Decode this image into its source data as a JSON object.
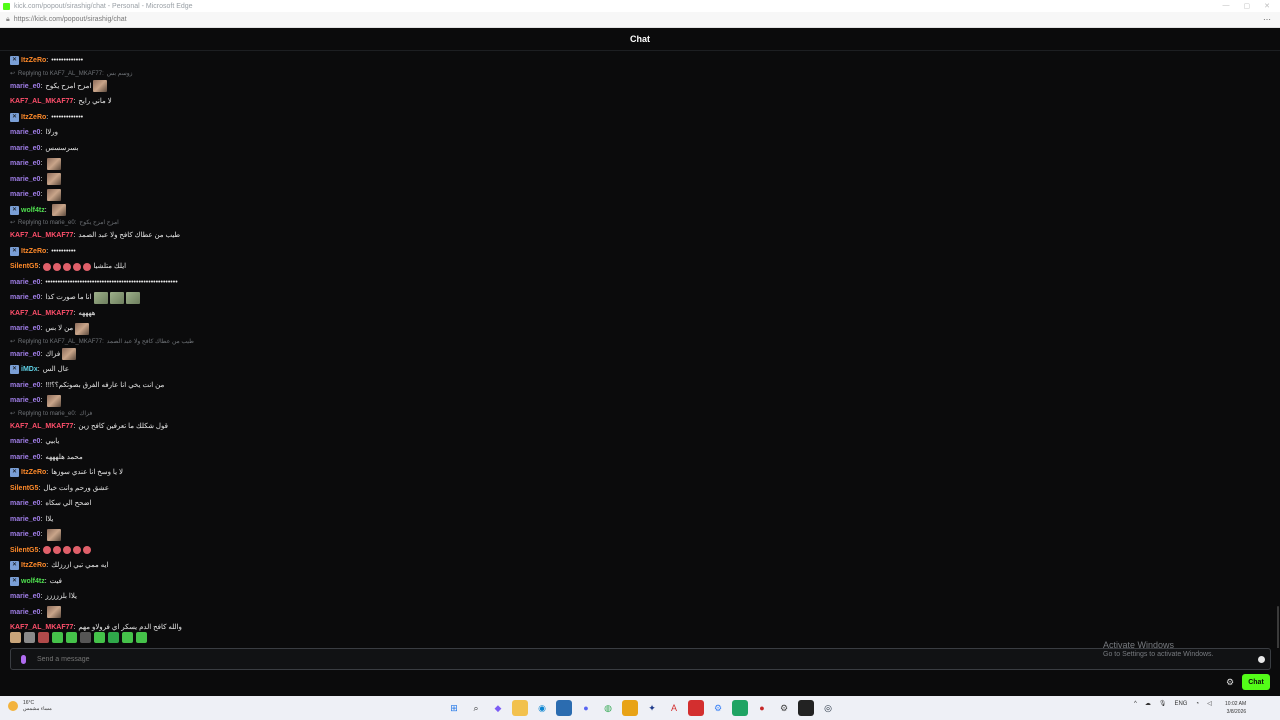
{
  "window": {
    "title": "kick.com/popout/sirashig/chat - Personal - Microsoft Edge",
    "url": "https://kick.com/popout/sirashig/chat"
  },
  "chat": {
    "header": "Chat",
    "colors": {
      "accent": "#53fc18",
      "bg": "#0b0b0c"
    },
    "messages": [
      {
        "user": "ItzZeRo",
        "color": "#ff8a2a",
        "badge": true,
        "text": "•••••••••••••"
      },
      {
        "reply_to": "Replying to KAF7_AL_MKAF77:",
        "reply_text": "زوسم بس",
        "user": "marie_e0",
        "color": "#a07ee8",
        "text": "امزح امزح يكوح",
        "emotes": 1
      },
      {
        "user": "KAF7_AL_MKAF77",
        "color": "#ff4f6b",
        "text": "لا ماني رايح"
      },
      {
        "user": "ItzZeRo",
        "color": "#ff8a2a",
        "badge": true,
        "text": "•••••••••••••"
      },
      {
        "user": "marie_e0",
        "color": "#a07ee8",
        "text": "ورلاا"
      },
      {
        "user": "marie_e0",
        "color": "#a07ee8",
        "text": "بسرسسس"
      },
      {
        "user": "marie_e0",
        "color": "#a07ee8",
        "text": "",
        "emotes": 1
      },
      {
        "user": "marie_e0",
        "color": "#a07ee8",
        "text": "",
        "emotes": 1
      },
      {
        "user": "marie_e0",
        "color": "#a07ee8",
        "text": "",
        "emotes": 1
      },
      {
        "user": "wolf4tz",
        "color": "#4fe04f",
        "badge": true,
        "text": "",
        "emotes": 1
      },
      {
        "reply_to": "Replying to marie_e0:",
        "reply_text": "امزح امزح يكوح",
        "user": "KAF7_AL_MKAF77",
        "color": "#ff4f6b",
        "text": "طيب من عطاك كافح ولا عبد الصمد"
      },
      {
        "user": "ItzZeRo",
        "color": "#ff8a2a",
        "badge": true,
        "text": "••••••••••"
      },
      {
        "user": "SilentG5",
        "color": "#ff8a2a",
        "text": "ايلك متلشيا",
        "smiles": 5
      },
      {
        "user": "marie_e0",
        "color": "#a07ee8",
        "text": "••••••••••••••••••••••••••••••••••••••••••••••••••••••"
      },
      {
        "user": "marie_e0",
        "color": "#a07ee8",
        "text": "انا ما صورت كذا",
        "emotes": 3
      },
      {
        "user": "KAF7_AL_MKAF77",
        "color": "#ff4f6b",
        "text": "ههههه"
      },
      {
        "user": "marie_e0",
        "color": "#a07ee8",
        "text": "من لا بس",
        "emotes": 1
      },
      {
        "reply_to": "Replying to KAF7_AL_MKAF77:",
        "reply_text": "طيب من عطاك كافح ولا عبد الصمد",
        "user": "marie_e0",
        "color": "#a07ee8",
        "text": "فزاك",
        "emotes": 1
      },
      {
        "user": "iMDx",
        "color": "#5fd3e8",
        "badge": true,
        "text": "عال الس"
      },
      {
        "user": "marie_e0",
        "color": "#a07ee8",
        "text": "!!!من انت يخي انا عارفه الفرق بصوتكم؟؟"
      },
      {
        "user": "marie_e0",
        "color": "#a07ee8",
        "text": "",
        "emotes": 1
      },
      {
        "reply_to": "Replying to marie_e0:",
        "reply_text": "فزاك",
        "user": "KAF7_AL_MKAF77",
        "color": "#ff4f6b",
        "text": "قول شكلك ما تعرفين كافح زين"
      },
      {
        "user": "marie_e0",
        "color": "#a07ee8",
        "text": "يابيي"
      },
      {
        "user": "marie_e0",
        "color": "#a07ee8",
        "text": "محمد هلهههه"
      },
      {
        "user": "ItzZeRo",
        "color": "#ff8a2a",
        "badge": true,
        "text": "لا يا وسخ انا عندي سوزها"
      },
      {
        "user": "SilentG5",
        "color": "#ff8a2a",
        "text": "عشق ورحم وانت خيال"
      },
      {
        "user": "marie_e0",
        "color": "#a07ee8",
        "text": "اضحح الي سكاه"
      },
      {
        "user": "marie_e0",
        "color": "#a07ee8",
        "text": "يلاا"
      },
      {
        "user": "marie_e0",
        "color": "#a07ee8",
        "text": "",
        "emotes": 1
      },
      {
        "user": "SilentG5",
        "color": "#ff8a2a",
        "text": "",
        "smiles": 5
      },
      {
        "user": "ItzZeRo",
        "color": "#ff8a2a",
        "badge": true,
        "text": "ايه ممي تبي ازرزلك"
      },
      {
        "user": "wolf4tz",
        "color": "#4fe04f",
        "badge": true,
        "text": "فيت"
      },
      {
        "user": "marie_e0",
        "color": "#a07ee8",
        "text": "يلاا بلززززز"
      },
      {
        "user": "marie_e0",
        "color": "#a07ee8",
        "text": "",
        "emotes": 1
      },
      {
        "user": "KAF7_AL_MKAF77",
        "color": "#ff4f6b",
        "text": "والله كافح الدم يسكر اي فرولاو مهم"
      }
    ],
    "input_placeholder": "Send a message",
    "chat_button": "Chat",
    "emote_strip": [
      "#c9a57a",
      "#8a8a8a",
      "#b04a4a",
      "#45c24a",
      "#45c24a",
      "#555555",
      "#45c24a",
      "#2fa84a",
      "#45c24a",
      "#45c24a"
    ]
  },
  "activate_windows": {
    "title": "Activate Windows",
    "subtitle": "Go to Settings to activate Windows."
  },
  "taskbar": {
    "weather_temp": "16°C",
    "weather_desc": "مساء مشمس",
    "lang": "ENG",
    "time": "10:02 AM",
    "date": "3/8/2026"
  }
}
